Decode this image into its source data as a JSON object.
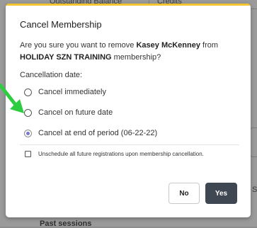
{
  "background": {
    "tab_outstanding_balance": "Outstanding Balance",
    "tab_credits": "Credits",
    "past_sessions": "Past sessions",
    "edge_letter": "S"
  },
  "dialog": {
    "title": "Cancel Membership",
    "message_prefix": "Are you sure you want to remove ",
    "member_name": "Kasey McKenney",
    "message_middle": " from ",
    "membership_name": "HOLIDAY SZN TRAINING",
    "message_suffix": " membership?",
    "cancellation_date_label": "Cancellation date:",
    "options": [
      {
        "label": "Cancel immediately",
        "selected": false
      },
      {
        "label": "Cancel on future date",
        "selected": false
      },
      {
        "label": "Cancel at end of period (06-22-22)",
        "selected": true
      }
    ],
    "unschedule_label": "Unschedule all future registrations upon membership cancellation.",
    "unschedule_checked": false,
    "no_label": "No",
    "yes_label": "Yes"
  },
  "colors": {
    "accent_bar": "#f4c430",
    "radio_selected": "#7b78c9",
    "yes_button": "#3f4752",
    "annotation_arrow": "#2ecc40"
  }
}
